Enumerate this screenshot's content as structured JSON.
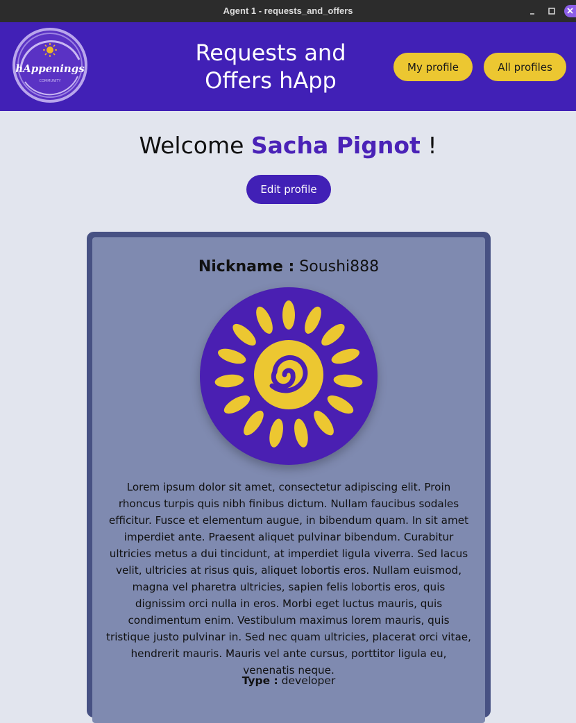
{
  "window": {
    "title": "Agent 1 - requests_and_offers"
  },
  "header": {
    "app_title": "Requests and Offers hApp",
    "logo_text": "hAppenings",
    "logo_subtext": "COMMUNITY",
    "my_profile_label": "My profile",
    "all_profiles_label": "All profiles"
  },
  "welcome": {
    "prefix": "Welcome",
    "name": "Sacha Pignot",
    "suffix": "!",
    "edit_profile_label": "Edit profile"
  },
  "profile": {
    "nickname_label": "Nickname :",
    "nickname": "Soushi888",
    "bio": "Lorem ipsum dolor sit amet, consectetur adipiscing elit. Proin rhoncus turpis quis nibh finibus dictum. Nullam faucibus sodales efficitur. Fusce et elementum augue, in bibendum quam. In sit amet imperdiet ante. Praesent aliquet pulvinar bibendum. Curabitur ultricies metus a dui tincidunt, at imperdiet ligula viverra. Sed lacus velit, ultricies at risus quis, aliquet lobortis eros. Nullam euismod, magna vel pharetra ultricies, sapien felis lobortis eros, quis dignissim orci nulla in eros. Morbi eget luctus mauris, quis condimentum enim. Vestibulum maximus lorem mauris, quis tristique justo pulvinar in. Sed nec quam ultricies, placerat orci vitae, hendrerit mauris. Mauris vel ante cursus, porttitor ligula eu, venenatis neque.",
    "type_label": "Type :",
    "type": "developer"
  },
  "colors": {
    "header_bg": "#4120b6",
    "accent_yellow": "#ecc731",
    "name_purple": "#4a22b7",
    "card_border": "#475183",
    "card_bg": "#7f8ab0",
    "page_bg": "#e2e5ee"
  },
  "icons": {
    "window_minimize": "minimize-icon",
    "window_maximize": "maximize-icon",
    "window_close": "close-icon",
    "logo": "happenings-logo",
    "avatar": "sun-spiral-avatar"
  }
}
